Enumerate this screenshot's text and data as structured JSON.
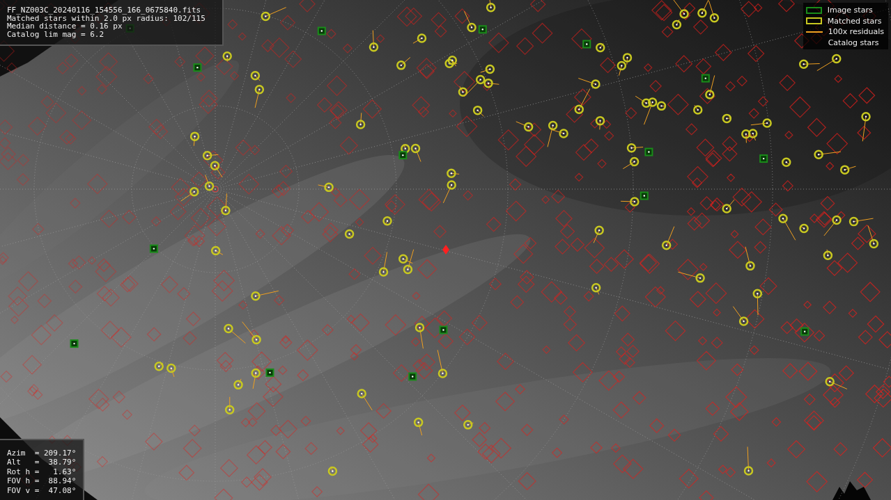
{
  "info": {
    "lines": [
      "FF_NZ003C_20240116_154556_166_0675840.fits",
      "Matched stars within 2.0 px radius: 102/115",
      "Median distance = 0.16 px",
      "Catalog lim mag = 6.2"
    ]
  },
  "legend": [
    {
      "kind": "box",
      "label": "Image stars",
      "color": "#1a8c1a"
    },
    {
      "kind": "box",
      "label": "Matched stars",
      "color": "#c8c820"
    },
    {
      "kind": "line",
      "label": "100x residuals",
      "color": "#f0a020"
    },
    {
      "kind": "none",
      "label": "Catalog stars"
    }
  ],
  "pointing": {
    "lines": [
      "Azim  = 209.17°",
      "Alt   =  38.79°",
      "Rot h =   1.63°",
      "FOV h =  88.94°",
      "FOV v =  47.08°"
    ]
  }
}
